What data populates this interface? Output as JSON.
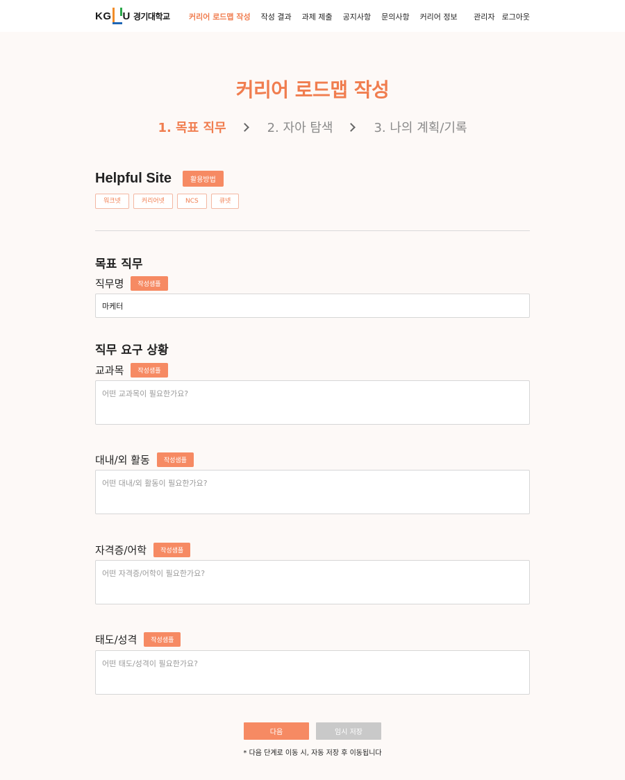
{
  "header": {
    "logo_abbr_left": "KG",
    "logo_abbr_right": "U",
    "logo_text": "경기대학교",
    "nav": [
      {
        "label": "커리어 로드맵 작성",
        "active": true
      },
      {
        "label": "작성 결과",
        "active": false
      },
      {
        "label": "과제 제출",
        "active": false
      },
      {
        "label": "공지사항",
        "active": false
      },
      {
        "label": "문의사항",
        "active": false
      },
      {
        "label": "커리어 정보",
        "active": false
      }
    ],
    "admin_label": "관리자",
    "logout_label": "로그아웃"
  },
  "page": {
    "title": "커리어 로드맵 작성",
    "steps": [
      "1. 목표 직무",
      "2. 자아 탐색",
      "3. 나의 계획/기록"
    ],
    "active_step": 0
  },
  "helpful": {
    "title": "Helpful Site",
    "usage_label": "활용방법",
    "links": [
      "워크넷",
      "커리어넷",
      "NCS",
      "큐넷"
    ]
  },
  "target_job": {
    "section_title": "목표 직무",
    "job_label": "직무명",
    "example_label": "작성샘플",
    "job_value": "마케터"
  },
  "requirements": {
    "section_title": "직무 요구 상황",
    "fields": [
      {
        "label": "교과목",
        "example_label": "작성샘플",
        "placeholder": "어떤 교과목이 필요한가요?"
      },
      {
        "label": "대내/외 활동",
        "example_label": "작성샘플",
        "placeholder": "어떤 대내/외 활동이 필요한가요?"
      },
      {
        "label": "자격증/어학",
        "example_label": "작성샘플",
        "placeholder": "어떤 자격증/어학이 필요한가요?"
      },
      {
        "label": "태도/성격",
        "example_label": "작성샘플",
        "placeholder": "어떤 태도/성격이 필요한가요?"
      }
    ]
  },
  "actions": {
    "next_label": "다음",
    "save_label": "임시 저장",
    "notice": "* 다음 단계로 이동 시, 자동 저장 후 이동됩니다"
  },
  "colors": {
    "accent": "#f07d4f",
    "badge": "#f68a63",
    "disabled": "#c9c9c9",
    "background": "#fdf9f7"
  }
}
